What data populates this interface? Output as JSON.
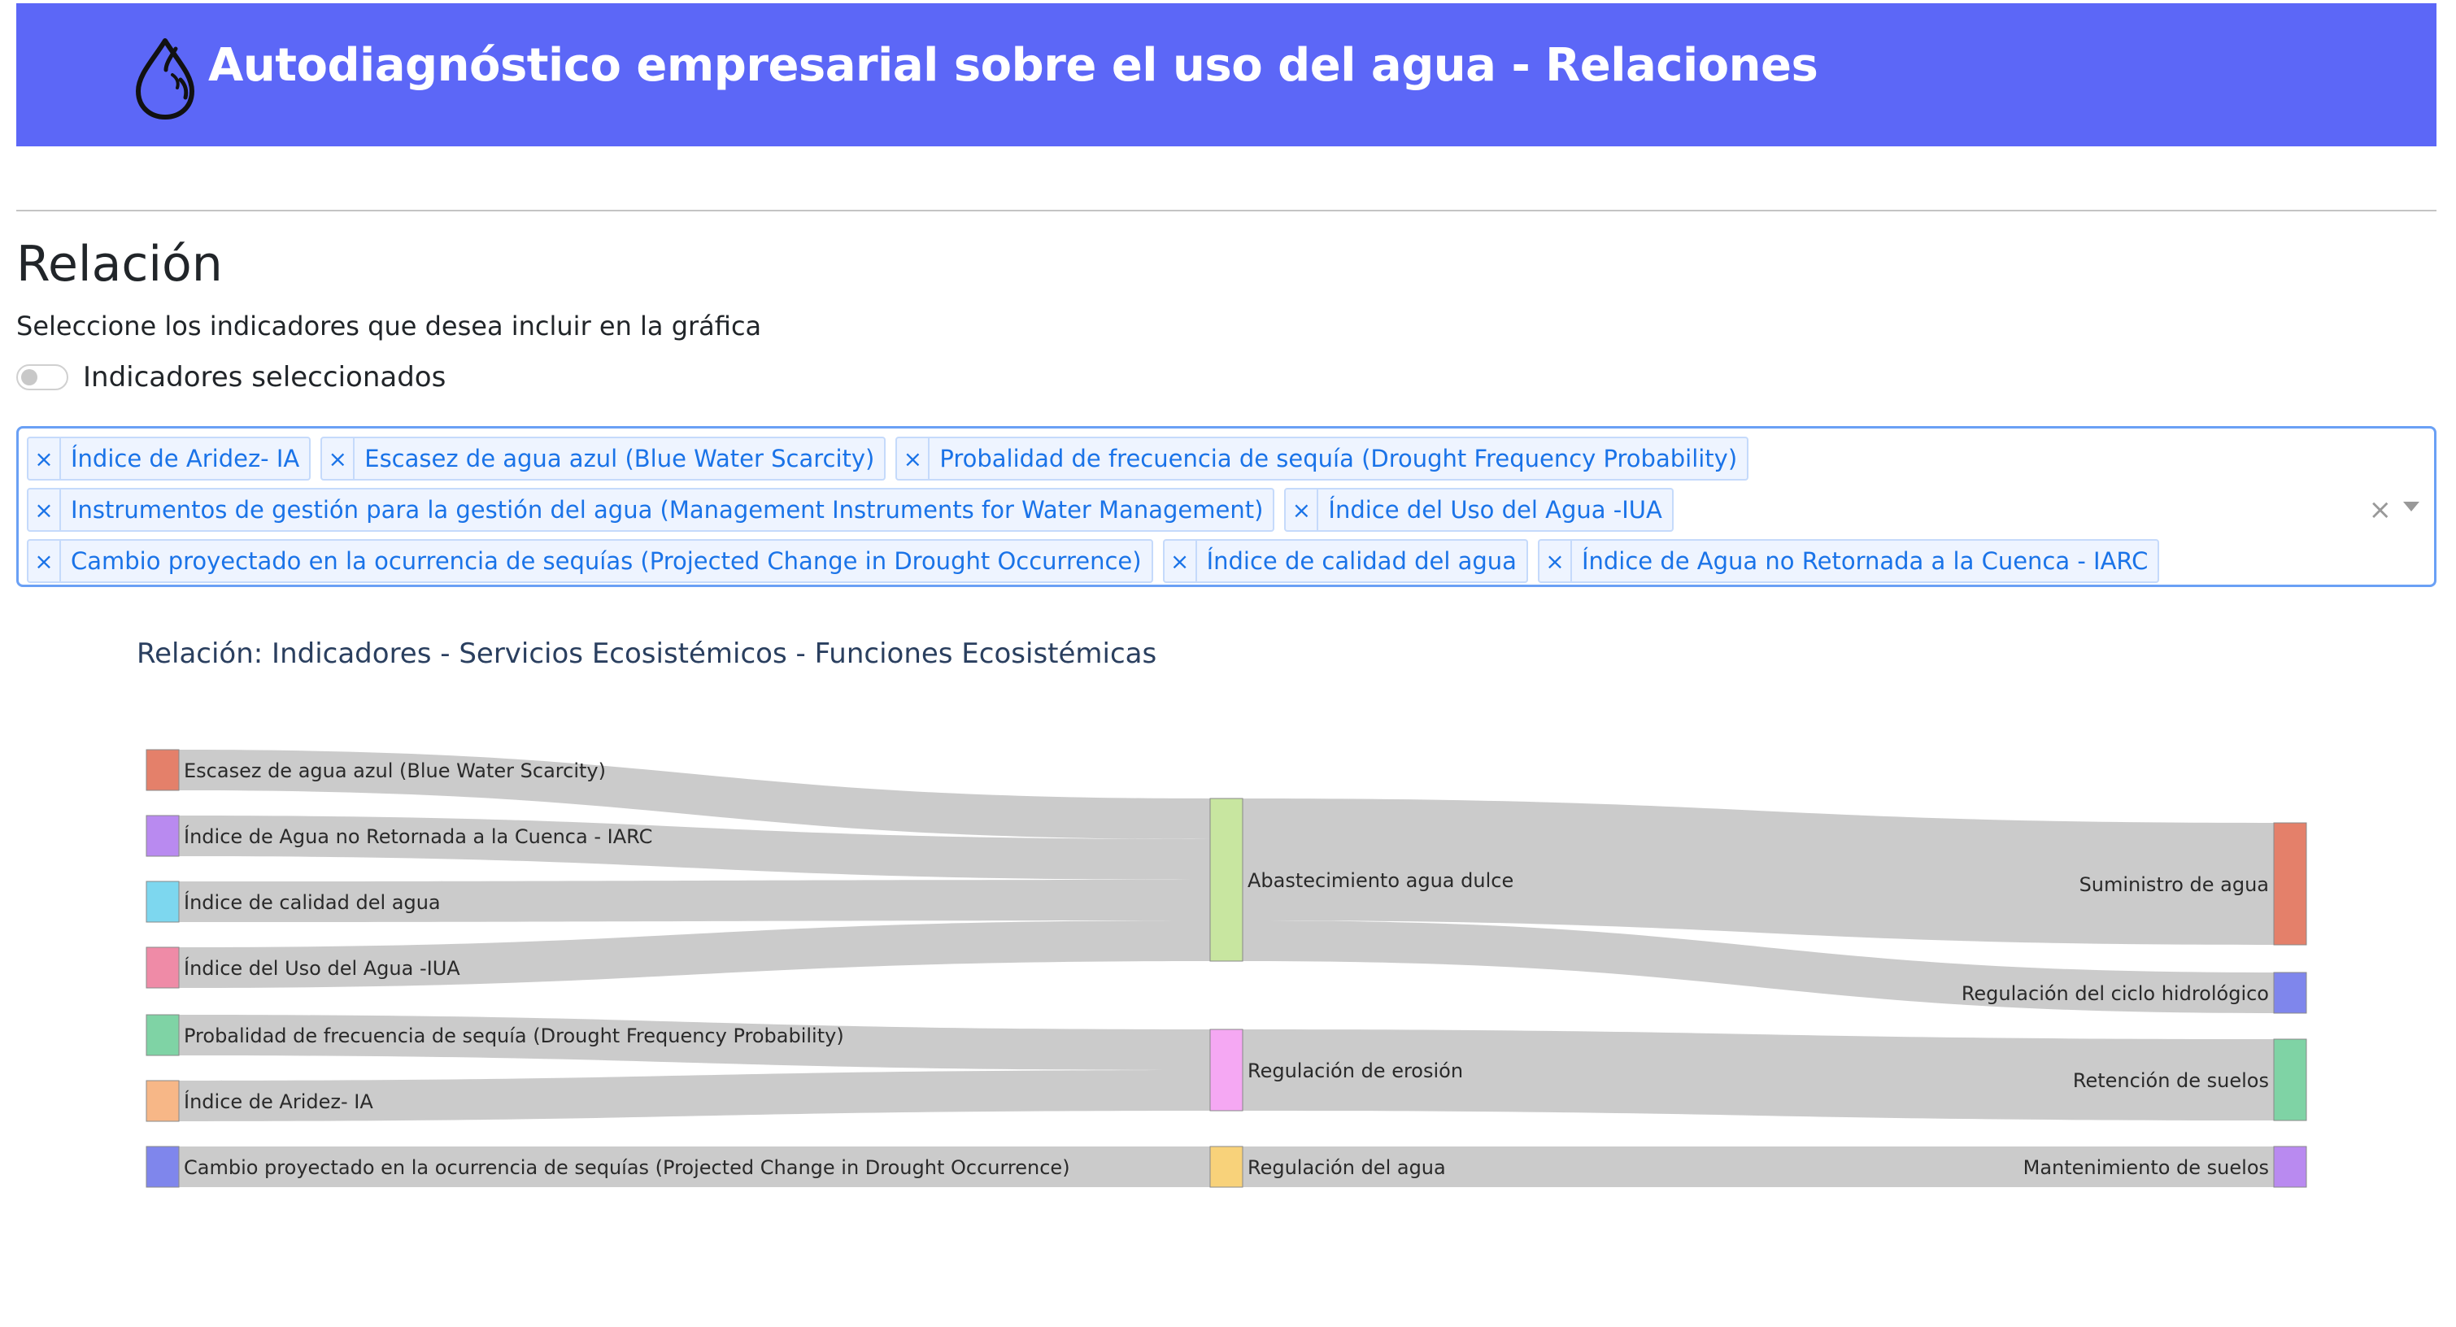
{
  "header": {
    "title": "Autodiagnóstico empresarial sobre el uso del agua - Relaciones",
    "icon": "water-drop-icon",
    "background": "#5c67f7"
  },
  "section": {
    "title": "Relación",
    "subtitle": "Seleccione los indicadores que desea incluir en la gráfica",
    "toggle_label": "Indicadores seleccionados",
    "toggle_on": false
  },
  "selector": {
    "remove_glyph": "×",
    "clear_glyph": "×",
    "rows": [
      [
        "Índice de Aridez- IA",
        "Escasez de agua azul (Blue Water Scarcity)",
        "Probalidad de frecuencia de sequía (Drought Frequency Probability)"
      ],
      [
        "Instrumentos de gestión para la gestión del agua (Management Instruments for Water Management)",
        "Índice del Uso del Agua -IUA"
      ],
      [
        "Cambio proyectado en la ocurrencia de sequías (Projected Change in Drought Occurrence)",
        "Índice de calidad del agua",
        "Índice de Agua no Retornada a la Cuenca - IARC"
      ]
    ]
  },
  "chart_data": {
    "type": "sankey",
    "title": "Relación: Indicadores - Servicios Ecosistémicos - Funciones Ecosistémicas",
    "nodes": [
      {
        "id": "escasez",
        "label": "Escasez de agua azul (Blue Water Scarcity)",
        "column": 0,
        "color": "#e4806a"
      },
      {
        "id": "iarc",
        "label": "Índice de Agua no Retornada a la Cuenca - IARC",
        "column": 0,
        "color": "#b98af0"
      },
      {
        "id": "calidad",
        "label": "Índice de calidad del agua",
        "column": 0,
        "color": "#7dd7ef"
      },
      {
        "id": "iua",
        "label": "Índice del Uso del Agua -IUA",
        "column": 0,
        "color": "#ef8ba7"
      },
      {
        "id": "probabilidad",
        "label": "Probalidad de frecuencia de sequía (Drought Frequency Probability)",
        "column": 0,
        "color": "#7fd3a5"
      },
      {
        "id": "aridez",
        "label": "Índice de Aridez- IA",
        "column": 0,
        "color": "#f7b787"
      },
      {
        "id": "cambio",
        "label": "Cambio proyectado en la ocurrencia de sequías (Projected Change in Drought Occurrence)",
        "column": 0,
        "color": "#7f86ec"
      },
      {
        "id": "abastecimiento",
        "label": "Abastecimiento agua dulce",
        "column": 1,
        "color": "#c8e6a0"
      },
      {
        "id": "erosion",
        "label": "Regulación de erosión",
        "column": 1,
        "color": "#f5a8f3"
      },
      {
        "id": "regagua",
        "label": "Regulación del agua",
        "column": 1,
        "color": "#f8d27a"
      },
      {
        "id": "suministro",
        "label": "Suministro de agua",
        "column": 2,
        "color": "#e4806a"
      },
      {
        "id": "ciclo",
        "label": "Regulación del ciclo hidrológico",
        "column": 2,
        "color": "#7f86ec"
      },
      {
        "id": "retencion",
        "label": "Retención de suelos",
        "column": 2,
        "color": "#7fd3a5"
      },
      {
        "id": "mantenimiento",
        "label": "Mantenimiento de suelos",
        "column": 2,
        "color": "#b98af0"
      }
    ],
    "links": [
      {
        "source": "escasez",
        "target": "abastecimiento",
        "value": 1
      },
      {
        "source": "iarc",
        "target": "abastecimiento",
        "value": 1
      },
      {
        "source": "calidad",
        "target": "abastecimiento",
        "value": 1
      },
      {
        "source": "iua",
        "target": "abastecimiento",
        "value": 1
      },
      {
        "source": "probabilidad",
        "target": "erosion",
        "value": 1
      },
      {
        "source": "aridez",
        "target": "erosion",
        "value": 1
      },
      {
        "source": "cambio",
        "target": "regagua",
        "value": 1
      },
      {
        "source": "abastecimiento",
        "target": "suministro",
        "value": 3
      },
      {
        "source": "abastecimiento",
        "target": "ciclo",
        "value": 1
      },
      {
        "source": "erosion",
        "target": "retencion",
        "value": 2
      },
      {
        "source": "regagua",
        "target": "mantenimiento",
        "value": 1
      }
    ],
    "link_color": "#c8c8c8"
  }
}
